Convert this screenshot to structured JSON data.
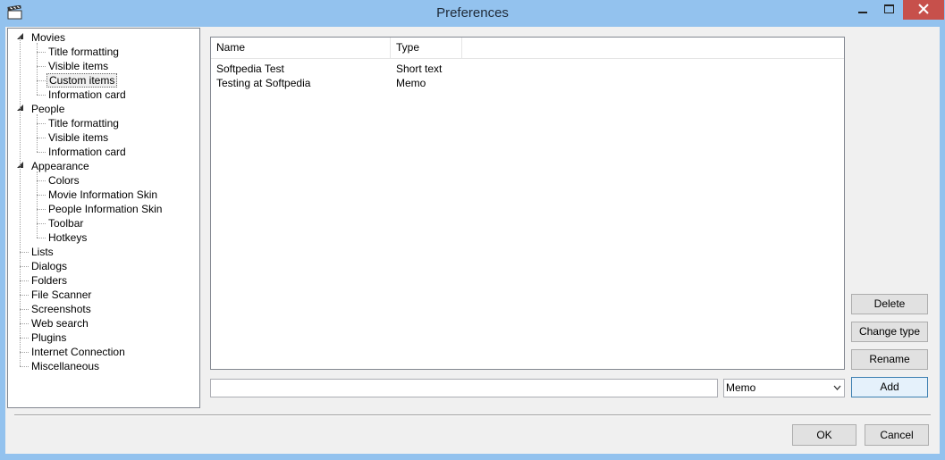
{
  "window": {
    "title": "Preferences",
    "accent": "#93c2ee",
    "close_color": "#c7504b"
  },
  "tree": {
    "items": [
      {
        "label": "Movies",
        "level": 0,
        "expanded": true
      },
      {
        "label": "Title formatting",
        "level": 1
      },
      {
        "label": "Visible items",
        "level": 1
      },
      {
        "label": "Custom items",
        "level": 1,
        "selected": true
      },
      {
        "label": "Information card",
        "level": 1
      },
      {
        "label": "People",
        "level": 0,
        "expanded": true
      },
      {
        "label": "Title formatting",
        "level": 1
      },
      {
        "label": "Visible items",
        "level": 1
      },
      {
        "label": "Information card",
        "level": 1
      },
      {
        "label": "Appearance",
        "level": 0,
        "expanded": true
      },
      {
        "label": "Colors",
        "level": 1
      },
      {
        "label": "Movie Information Skin",
        "level": 1
      },
      {
        "label": "People Information Skin",
        "level": 1
      },
      {
        "label": "Toolbar",
        "level": 1
      },
      {
        "label": "Hotkeys",
        "level": 1
      },
      {
        "label": "Lists",
        "level": 0
      },
      {
        "label": "Dialogs",
        "level": 0
      },
      {
        "label": "Folders",
        "level": 0
      },
      {
        "label": "File Scanner",
        "level": 0
      },
      {
        "label": "Screenshots",
        "level": 0
      },
      {
        "label": "Web search",
        "level": 0
      },
      {
        "label": "Plugins",
        "level": 0
      },
      {
        "label": "Internet Connection",
        "level": 0
      },
      {
        "label": "Miscellaneous",
        "level": 0
      }
    ]
  },
  "list": {
    "columns": [
      "Name",
      "Type"
    ],
    "rows": [
      [
        "Softpedia Test",
        "Short text"
      ],
      [
        "Testing at Softpedia",
        "Memo"
      ]
    ]
  },
  "editor": {
    "name_value": "",
    "type_selected": "Memo"
  },
  "buttons": {
    "delete": "Delete",
    "change_type": "Change type",
    "rename": "Rename",
    "add": "Add",
    "ok": "OK",
    "cancel": "Cancel"
  }
}
